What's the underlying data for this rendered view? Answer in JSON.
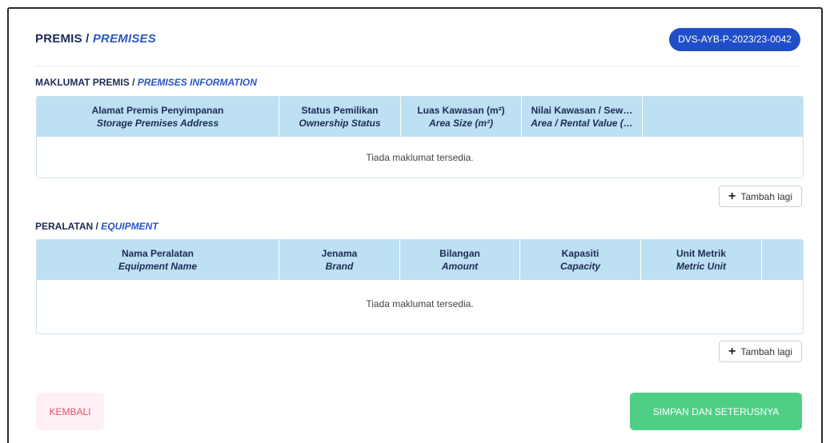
{
  "header": {
    "title_ms": "PREMIS",
    "separator": " / ",
    "title_en": "PREMISES",
    "reference_badge": "DVS-AYB-P-2023/23-0042"
  },
  "premises_section": {
    "title_ms": "MAKLUMAT PREMIS",
    "separator": " / ",
    "title_en": "PREMISES INFORMATION",
    "columns": [
      {
        "ms": "Alamat Premis Penyimpanan",
        "en": "Storage Premises Address"
      },
      {
        "ms": "Status Pemilikan",
        "en": "Ownership Status"
      },
      {
        "ms": "Luas Kawasan (m²)",
        "en": "Area Size (m²)"
      },
      {
        "ms": "Nilai Kawasan / Sew…",
        "en": "Area / Rental Value (…"
      },
      {
        "ms": "",
        "en": ""
      }
    ],
    "empty_text": "Tiada maklumat tersedia.",
    "add_label": "Tambah lagi"
  },
  "equipment_section": {
    "title_ms": "PERALATAN",
    "separator": " / ",
    "title_en": "EQUIPMENT",
    "columns": [
      {
        "ms": "Nama Peralatan",
        "en": "Equipment Name"
      },
      {
        "ms": "Jenama",
        "en": "Brand"
      },
      {
        "ms": "Bilangan",
        "en": "Amount"
      },
      {
        "ms": "Kapasiti",
        "en": "Capacity"
      },
      {
        "ms": "Unit Metrik",
        "en": "Metric Unit"
      },
      {
        "ms": "",
        "en": ""
      }
    ],
    "empty_text": "Tiada maklumat tersedia.",
    "add_label": "Tambah lagi"
  },
  "footer": {
    "back_label": "KEMBALI",
    "save_label": "SIMPAN DAN SETERUSNYA"
  },
  "colors": {
    "badge": "#1f4ec8",
    "table_header": "#bde0f2",
    "save_button": "#4fcf86",
    "back_button_bg": "#fff0f3",
    "back_button_text": "#e0506a"
  },
  "icons": {
    "add": "plus-icon"
  }
}
